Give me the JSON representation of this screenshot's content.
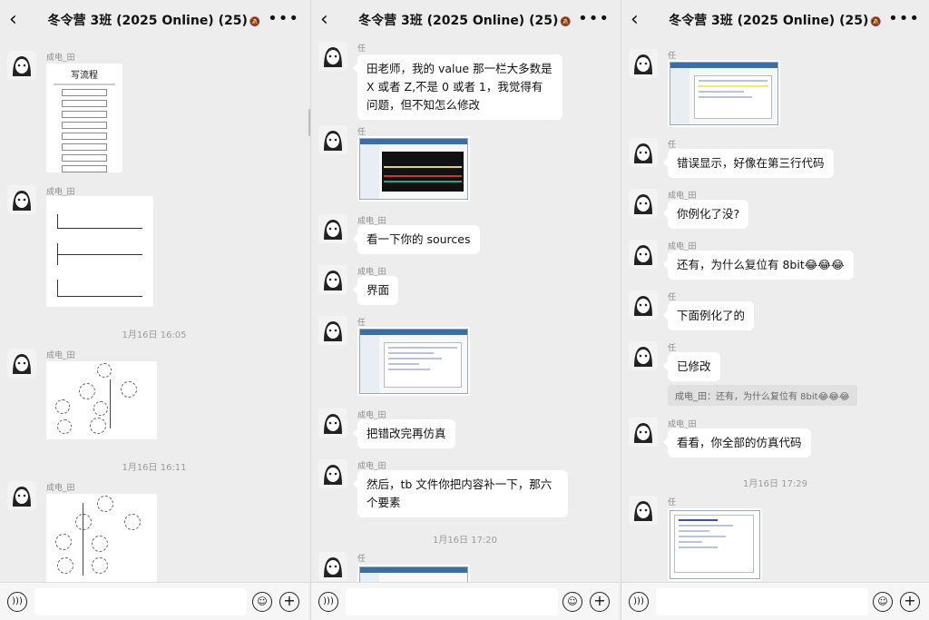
{
  "header": {
    "title": "冬令营 3班 (2025 Online) (25)",
    "back_icon": "chevron-left-icon",
    "mute_icon": "bell-off-icon",
    "more_icon": "ellipsis-icon"
  },
  "panel1": {
    "messages": [
      {
        "sender": "成电_田",
        "type": "image",
        "image_title": "写流程"
      },
      {
        "sender": "成电_田",
        "type": "image"
      },
      {
        "time": "1月16日 16:05"
      },
      {
        "sender": "成电_田",
        "type": "image"
      },
      {
        "time": "1月16日 16:11"
      },
      {
        "sender": "成电_田",
        "type": "image"
      }
    ]
  },
  "panel2": {
    "messages": [
      {
        "sender": "任",
        "type": "text",
        "text": "田老师，我的 value 那一栏大多数是 X 或者 Z,不是 0 或者 1，我觉得有问题，但不知怎么修改"
      },
      {
        "sender": "任",
        "type": "image"
      },
      {
        "sender": "成电_田",
        "type": "text",
        "text": "看一下你的 sources"
      },
      {
        "sender": "成电_田",
        "type": "text",
        "text": "界面"
      },
      {
        "sender": "任",
        "type": "image"
      },
      {
        "sender": "成电_田",
        "type": "text",
        "text": "把错改完再仿真"
      },
      {
        "sender": "成电_田",
        "type": "text",
        "text": "然后，tb 文件你把内容补一下，那六个要素"
      },
      {
        "time": "1月16日 17:20"
      },
      {
        "sender": "任",
        "type": "image"
      }
    ]
  },
  "panel3": {
    "messages": [
      {
        "sender": "任",
        "type": "image"
      },
      {
        "sender": "任",
        "type": "text",
        "text": "错误显示，好像在第三行代码"
      },
      {
        "sender": "成电_田",
        "type": "text",
        "text": "你例化了没?"
      },
      {
        "sender": "成电_田",
        "type": "text",
        "text": "还有，为什么复位有 8bit😂😂😂"
      },
      {
        "sender": "任",
        "type": "text",
        "text": "下面例化了的"
      },
      {
        "sender": "任",
        "type": "text",
        "text": "已修改"
      },
      {
        "quote": "成电_田：还有，为什么复位有 8bit😂😂😂"
      },
      {
        "sender": "成电_田",
        "type": "text",
        "text": "看看，你全部的仿真代码"
      },
      {
        "time": "1月16日 17:29"
      },
      {
        "sender": "任",
        "type": "image"
      }
    ]
  },
  "inputbar": {
    "voice_icon": "voice-icon",
    "emoji_icon": "emoji-icon",
    "plus_icon": "plus-icon"
  }
}
